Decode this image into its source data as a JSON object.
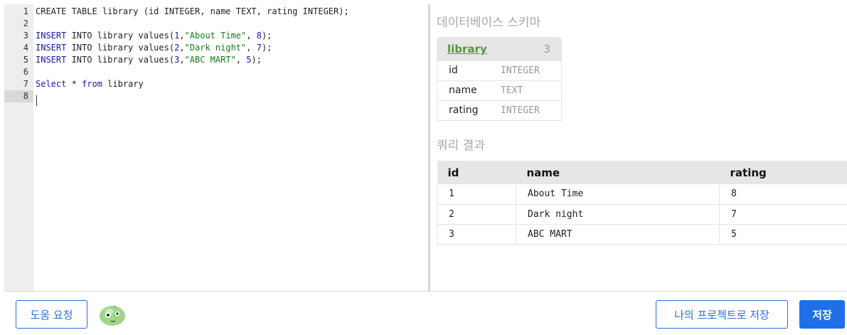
{
  "editor": {
    "line_numbers": [
      "1",
      "2",
      "3",
      "4",
      "5",
      "6",
      "7",
      "8"
    ],
    "active_line": "8",
    "lines": [
      [
        {
          "t": "CREATE TABLE library (id INTEGER, name TEXT, rating INTEGER);",
          "c": ""
        }
      ],
      [],
      [
        {
          "t": "INSERT",
          "c": "kw"
        },
        {
          "t": " INTO library values(",
          "c": ""
        },
        {
          "t": "1",
          "c": "num"
        },
        {
          "t": ",",
          "c": ""
        },
        {
          "t": "\"About Time\"",
          "c": "str"
        },
        {
          "t": ", ",
          "c": ""
        },
        {
          "t": "8",
          "c": "num"
        },
        {
          "t": ");",
          "c": ""
        }
      ],
      [
        {
          "t": "INSERT",
          "c": "kw"
        },
        {
          "t": " INTO library values(",
          "c": ""
        },
        {
          "t": "2",
          "c": "num"
        },
        {
          "t": ",",
          "c": ""
        },
        {
          "t": "\"Dark night\"",
          "c": "str"
        },
        {
          "t": ", ",
          "c": ""
        },
        {
          "t": "7",
          "c": "num"
        },
        {
          "t": ");",
          "c": ""
        }
      ],
      [
        {
          "t": "INSERT",
          "c": "kw"
        },
        {
          "t": " INTO library values(",
          "c": ""
        },
        {
          "t": "3",
          "c": "num"
        },
        {
          "t": ",",
          "c": ""
        },
        {
          "t": "\"ABC MART\"",
          "c": "str"
        },
        {
          "t": ", ",
          "c": ""
        },
        {
          "t": "5",
          "c": "num"
        },
        {
          "t": ");",
          "c": ""
        }
      ],
      [],
      [
        {
          "t": "Select",
          "c": "kw"
        },
        {
          "t": " * ",
          "c": ""
        },
        {
          "t": "from",
          "c": "kw"
        },
        {
          "t": " library",
          "c": ""
        }
      ],
      []
    ]
  },
  "schema_panel": {
    "title": "데이터베이스 스키마",
    "table_name": "library",
    "column_count": "3",
    "columns": [
      {
        "name": "id",
        "type": "INTEGER"
      },
      {
        "name": "name",
        "type": "TEXT"
      },
      {
        "name": "rating",
        "type": "INTEGER"
      }
    ]
  },
  "results_panel": {
    "title": "쿼리 결과",
    "headers": [
      "id",
      "name",
      "rating"
    ],
    "rows": [
      [
        "1",
        "About Time",
        "8"
      ],
      [
        "2",
        "Dark night",
        "7"
      ],
      [
        "3",
        "ABC MART",
        "5"
      ]
    ]
  },
  "footer": {
    "help_button": "도움 요청",
    "save_project_button": "나의 프로젝트로 저장",
    "save_button": "저장"
  },
  "colors": {
    "accent": "#1e6fe8",
    "keyword": "#1a1aa6",
    "string": "#1a7a1a",
    "schema_link": "#4e9a3a"
  },
  "icons": {
    "mascot": "green-blob-mascot-icon"
  }
}
